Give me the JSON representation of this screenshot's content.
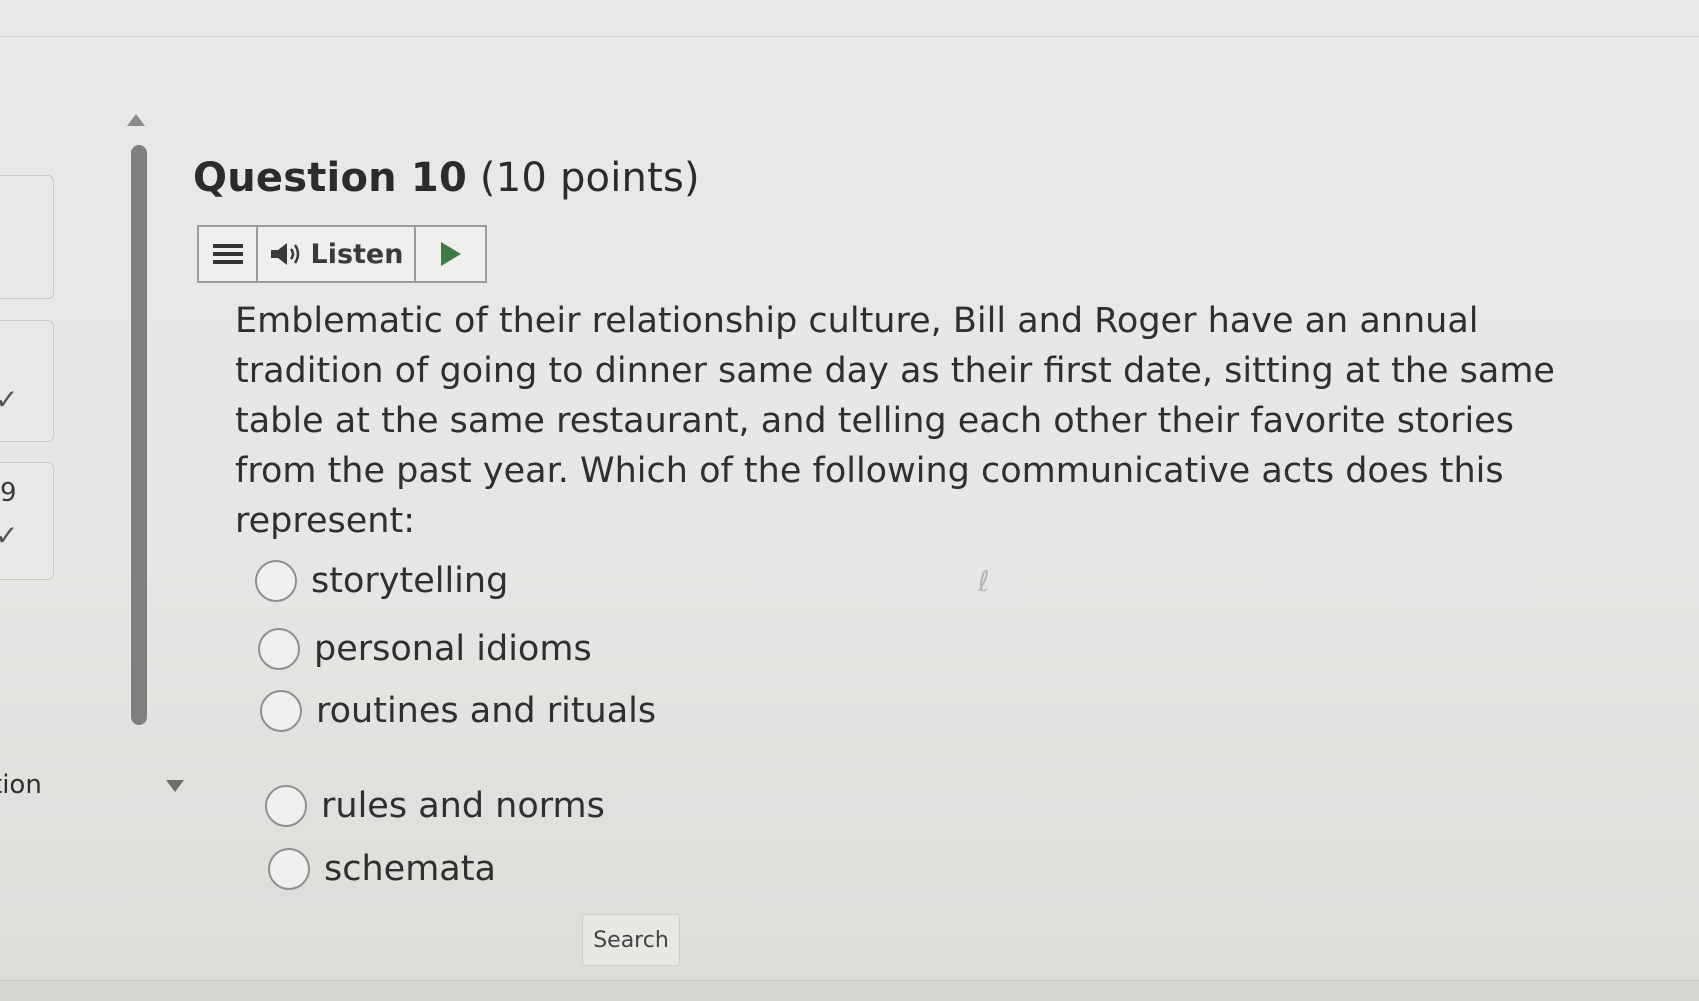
{
  "question": {
    "title_number": "Question 10",
    "title_points": "(10 points)",
    "text": "Emblematic of their relationship culture, Bill and Roger have an annual tradition of going to dinner same day as their first date, sitting at the same table at the same restaurant, and telling each other their favorite stories from the past year. Which of the following communicative acts does this represent:"
  },
  "toolbar": {
    "listen_label": "Listen"
  },
  "options": [
    {
      "label": "storytelling"
    },
    {
      "label": "personal idioms"
    },
    {
      "label": "routines and rituals"
    },
    {
      "label": "rules and norms"
    },
    {
      "label": "schemata"
    }
  ],
  "left_nav": {
    "number": "9",
    "label": "tion"
  },
  "search": {
    "label": "Search"
  }
}
